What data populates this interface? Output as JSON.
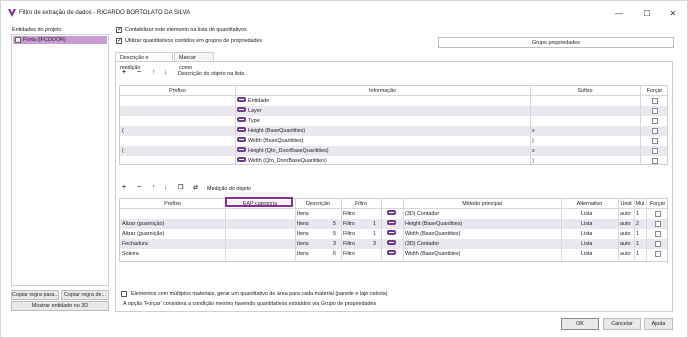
{
  "window": {
    "title": "Filtro de extração de dados - RICARDO BORTOLATO DA SILVA",
    "minimize": "—",
    "maximize": "☐",
    "close": "✕"
  },
  "left": {
    "label": "Entidades do projeto",
    "items": [
      "Porta (IFCDOOR)"
    ],
    "btn_copy_rule_1": "Copiar regra para...",
    "btn_copy_rule_2": "Copiar regra de...",
    "btn_show_3d": "Mostrar entidade no 3D"
  },
  "options": {
    "count_label": "Contabilizar este elemento na lista de quantitativos",
    "count_checked": true,
    "use_groups_label": "Utilizar quantitativos contidos em grupos de propriedades",
    "use_groups_checked": true,
    "group_button": "Grupo propriedades"
  },
  "tabs": [
    "Descrição e medição",
    "Marcar como"
  ],
  "description_section": {
    "title": "Descrição do objeto na lista",
    "headers": [
      "Prefixo",
      "Informação",
      "Sufixo",
      "Forçar"
    ],
    "rows": [
      {
        "prefix": "",
        "info": "Entidade",
        "suffix": ""
      },
      {
        "prefix": "",
        "info": "Layer",
        "suffix": ""
      },
      {
        "prefix": "",
        "info": "Type",
        "suffix": ""
      },
      {
        "prefix": "(",
        "info": "Height (BaseQuantities)",
        "suffix": "x"
      },
      {
        "prefix": "",
        "info": "Width (BaseQuantities)",
        "suffix": ")"
      },
      {
        "prefix": "(",
        "info": "Height (Qto_DoorBaseQuantities)",
        "suffix": "x"
      },
      {
        "prefix": "",
        "info": "Width (Qto_DoorBaseQuantities)",
        "suffix": ")"
      }
    ]
  },
  "measure_section": {
    "title": "Medição do objeto",
    "headers": [
      "Prefixo",
      "EAP categoria",
      "Descrição",
      "Filtro",
      "",
      "Método principal",
      "Alternativo",
      "Unid",
      "Mul",
      "Forçar"
    ],
    "rows": [
      {
        "prefix": "",
        "eap": "",
        "desc": "Itens",
        "desc_n": "",
        "filter": "Filtro",
        "filter_n": "",
        "method": "(3D) Contador",
        "alt": "Lista",
        "unit": "auto",
        "mul": "1"
      },
      {
        "prefix": "Alizar (guarnição)",
        "eap": "",
        "desc": "Itens",
        "desc_n": "5",
        "filter": "Filtro",
        "filter_n": "1",
        "method": "Height (BaseQuantities)",
        "alt": "Lista",
        "unit": "auto",
        "mul": "2"
      },
      {
        "prefix": "Alizar (guarnição)",
        "eap": "",
        "desc": "Itens",
        "desc_n": "5",
        "filter": "Filtro",
        "filter_n": "1",
        "method": "Width (BaseQuantities)",
        "alt": "Lista",
        "unit": "auto",
        "mul": "1"
      },
      {
        "prefix": "Fechadura",
        "eap": "",
        "desc": "Itens",
        "desc_n": "3",
        "filter": "Filtro",
        "filter_n": "3",
        "method": "(3D) Contador",
        "alt": "Lista",
        "unit": "auto",
        "mul": "1"
      },
      {
        "prefix": "Soleira",
        "eap": "",
        "desc": "Itens",
        "desc_n": "6",
        "filter": "Filtro",
        "filter_n": "",
        "method": "Width (BaseQuantities)",
        "alt": "Lista",
        "unit": "auto",
        "mul": "1"
      }
    ]
  },
  "footer": {
    "multi_material_label": "Elementos com múltiplos materiais, gerar um quantitativo de área para cada material (parede e laje cebola)",
    "multi_material_checked": false,
    "note": "A opção 'Forçar' considera a condição mesmo havendo quantitativos extraídos via Grupo de propriedades",
    "ok": "OK",
    "cancel": "Cancelar",
    "help": "Ajuda"
  },
  "colors": {
    "accent": "#c99cd3",
    "highlight": "#8b2d9a",
    "row_alt": "#ebe7ee",
    "icon_pill": "#6d3c8f"
  },
  "icons": [
    "app-logo-icon",
    "plus-icon",
    "minus-icon",
    "arrow-up-icon",
    "arrow-down-icon",
    "copy-icon",
    "measure-icon",
    "door-icon"
  ]
}
